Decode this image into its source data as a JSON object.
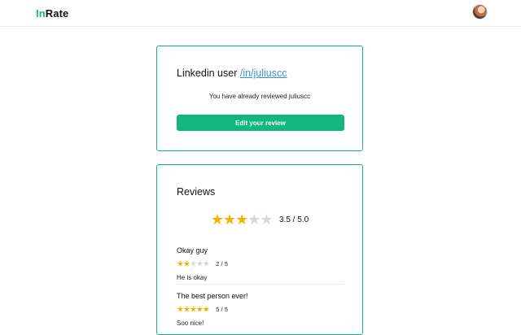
{
  "app": {
    "logo_in": "In",
    "logo_rate": "Rate"
  },
  "profile": {
    "title_prefix": "Linkedin user",
    "link": "/in/juliuscc",
    "status": "You have already reviewed juliuscc",
    "edit_label": "Edit your review"
  },
  "reviews": {
    "title": "Reviews",
    "average_rating": 3.5,
    "average_stars_filled": 3,
    "average_label": "3.5 / 5.0",
    "items": [
      {
        "title": "Okay guy",
        "rating": 2,
        "rating_label": "2 / 5",
        "body": "He is okay"
      },
      {
        "title": "The best person ever!",
        "rating": 5,
        "rating_label": "5 / 5",
        "body": "Soo nice!"
      }
    ]
  },
  "colors": {
    "accent": "#12b67f",
    "star_filled": "#f0b400",
    "star_empty": "#d6d8dc",
    "link": "#3a8fd9"
  },
  "icons": {
    "star": "star-icon",
    "avatar": "user-avatar"
  }
}
